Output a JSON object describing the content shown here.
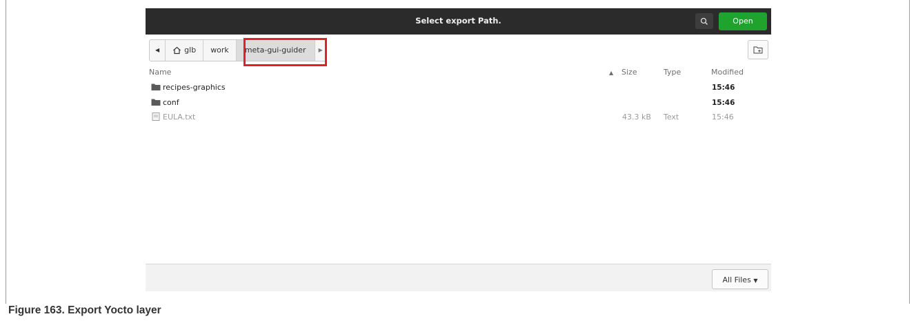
{
  "dialog": {
    "title": "Select export Path.",
    "open_label": "Open"
  },
  "pathbar": {
    "crumbs": [
      "glb",
      "work",
      "meta-gui-guider"
    ],
    "home_icon": "home-icon"
  },
  "columns": {
    "name": "Name",
    "size": "Size",
    "type": "Type",
    "modified": "Modified"
  },
  "files": [
    {
      "name": "recipes-graphics",
      "size": "",
      "type": "",
      "modified": "15:46",
      "icon": "folder-icon"
    },
    {
      "name": "conf",
      "size": "",
      "type": "",
      "modified": "15:46",
      "icon": "folder-icon"
    },
    {
      "name": "EULA.txt",
      "size": "43.3 kB",
      "type": "Text",
      "modified": "15:46",
      "icon": "text-file-icon"
    }
  ],
  "filter": {
    "label": "All Files"
  },
  "caption": "Figure 163.  Export Yocto layer",
  "colors": {
    "titlebar": "#2b2b2b",
    "open_button": "#1fa32c",
    "highlight": "#e0202b",
    "folder": "#5a5a5a"
  }
}
